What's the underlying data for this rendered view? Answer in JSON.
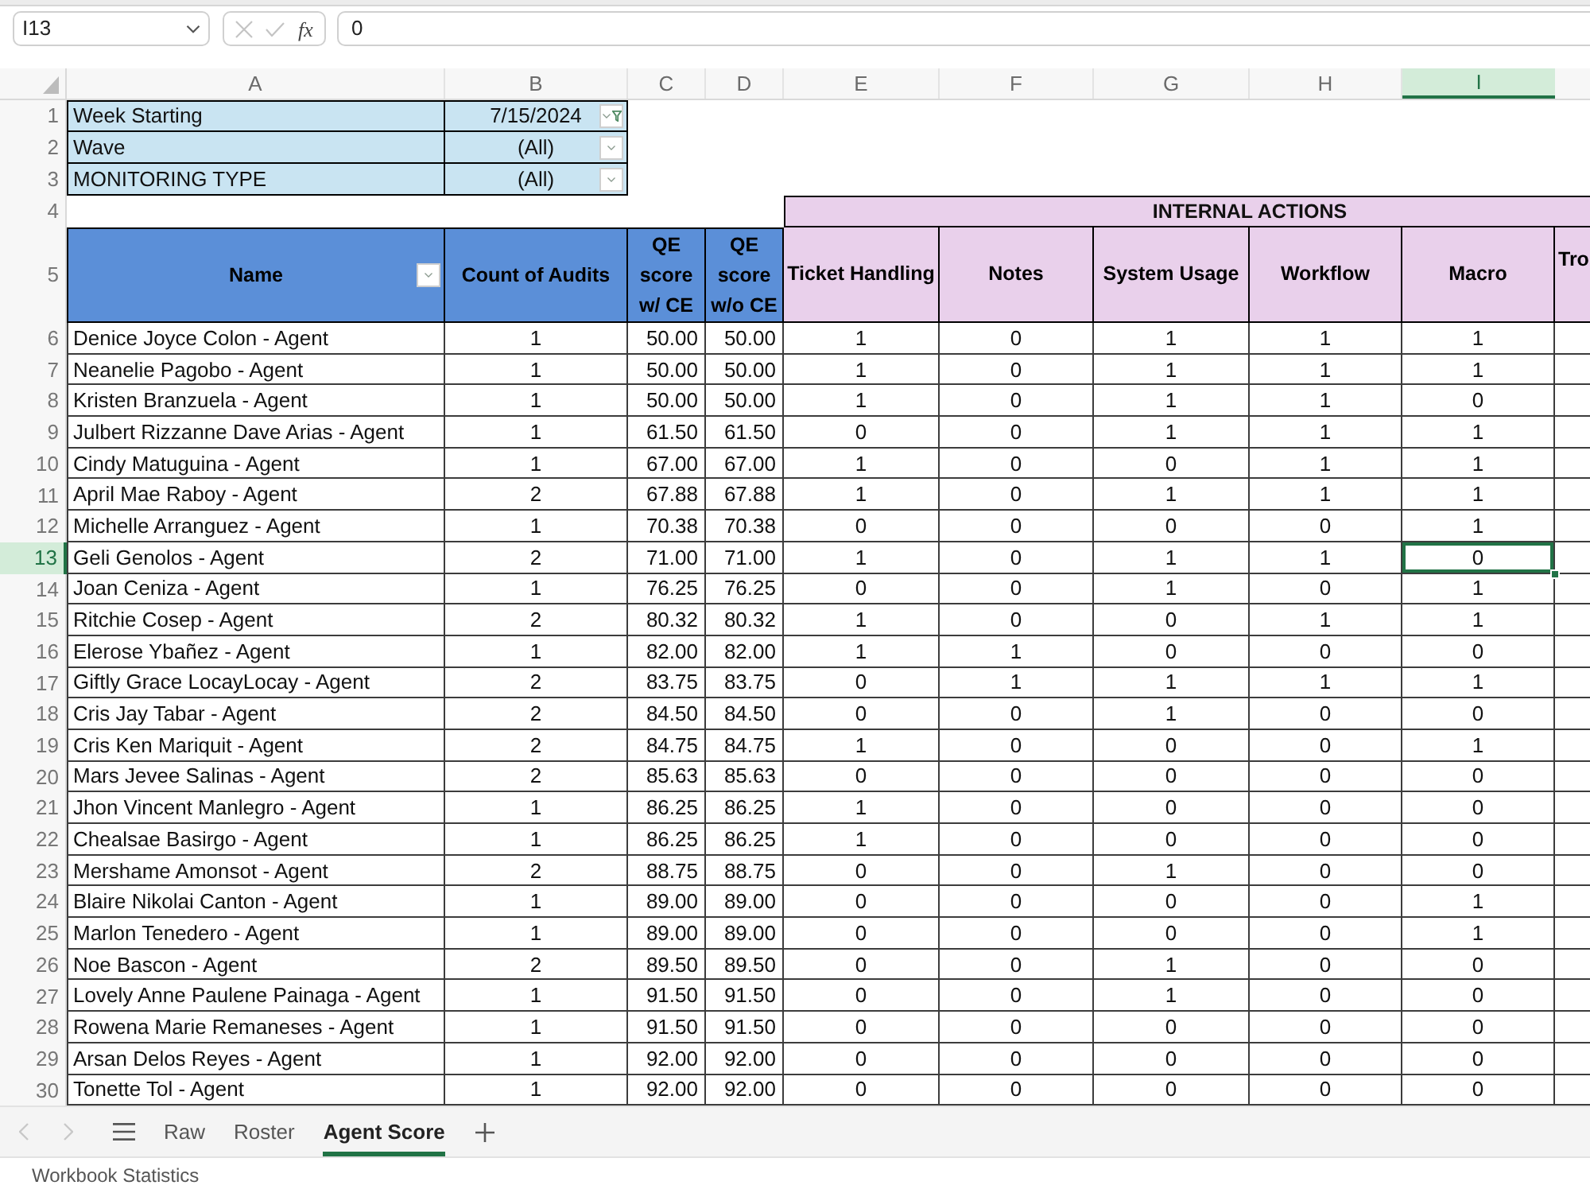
{
  "formula_bar": {
    "name_box": "I13",
    "function_label": "fx",
    "formula": "0",
    "editing": false
  },
  "columns": [
    {
      "label": "A",
      "selected": false
    },
    {
      "label": "B",
      "selected": false
    },
    {
      "label": "C",
      "selected": false
    },
    {
      "label": "D",
      "selected": false
    },
    {
      "label": "E",
      "selected": false
    },
    {
      "label": "F",
      "selected": false
    },
    {
      "label": "G",
      "selected": false
    },
    {
      "label": "H",
      "selected": false
    },
    {
      "label": "I",
      "selected": true
    }
  ],
  "filters": [
    {
      "row_number": "1",
      "label": "Week Starting",
      "value": "7/15/2024",
      "filtered": true
    },
    {
      "row_number": "2",
      "label": "Wave",
      "value": "(All)",
      "filtered": false
    },
    {
      "row_number": "3",
      "label": "MONITORING TYPE",
      "value": "(All)",
      "filtered": false
    }
  ],
  "group_row": {
    "row_number": "4",
    "label": "INTERNAL ACTIONS"
  },
  "header_row": {
    "row_number": "5",
    "cells": [
      {
        "text": "Name",
        "kind": "base",
        "dropdown": true
      },
      {
        "text": "Count of Audits",
        "kind": "base",
        "dropdown": false
      },
      {
        "text": "QE score w/ CE",
        "kind": "base",
        "dropdown": false
      },
      {
        "text": "QE score w/o CE",
        "kind": "base",
        "dropdown": false
      },
      {
        "text": "Ticket Handling",
        "kind": "action",
        "dropdown": false
      },
      {
        "text": "Notes",
        "kind": "action",
        "dropdown": false
      },
      {
        "text": "System Usage",
        "kind": "action",
        "dropdown": false
      },
      {
        "text": "Workflow",
        "kind": "action",
        "dropdown": false
      },
      {
        "text": "Macro",
        "kind": "action",
        "dropdown": false
      },
      {
        "text": "Tro",
        "kind": "action",
        "dropdown": false
      }
    ]
  },
  "rows": [
    {
      "row_number": "6",
      "selected": false,
      "cells": [
        "Denice Joyce Colon - Agent",
        "1",
        "50.00",
        "50.00",
        "1",
        "0",
        "1",
        "1",
        "1"
      ]
    },
    {
      "row_number": "7",
      "selected": false,
      "cells": [
        "Neanelie Pagobo - Agent",
        "1",
        "50.00",
        "50.00",
        "1",
        "0",
        "1",
        "1",
        "1"
      ]
    },
    {
      "row_number": "8",
      "selected": false,
      "cells": [
        "Kristen Branzuela - Agent",
        "1",
        "50.00",
        "50.00",
        "1",
        "0",
        "1",
        "1",
        "0"
      ]
    },
    {
      "row_number": "9",
      "selected": false,
      "cells": [
        "Julbert Rizzanne Dave Arias - Agent",
        "1",
        "61.50",
        "61.50",
        "0",
        "0",
        "1",
        "1",
        "1"
      ]
    },
    {
      "row_number": "10",
      "selected": false,
      "cells": [
        "Cindy Matuguina - Agent",
        "1",
        "67.00",
        "67.00",
        "1",
        "0",
        "0",
        "1",
        "1"
      ]
    },
    {
      "row_number": "11",
      "selected": false,
      "cells": [
        "April Mae Raboy - Agent",
        "2",
        "67.88",
        "67.88",
        "1",
        "0",
        "1",
        "1",
        "1"
      ]
    },
    {
      "row_number": "12",
      "selected": false,
      "cells": [
        "Michelle Arranguez - Agent",
        "1",
        "70.38",
        "70.38",
        "0",
        "0",
        "0",
        "0",
        "1"
      ]
    },
    {
      "row_number": "13",
      "selected": true,
      "cells": [
        "Geli Genolos - Agent",
        "2",
        "71.00",
        "71.00",
        "1",
        "0",
        "1",
        "1",
        "0"
      ]
    },
    {
      "row_number": "14",
      "selected": false,
      "cells": [
        "Joan Ceniza - Agent",
        "1",
        "76.25",
        "76.25",
        "0",
        "0",
        "1",
        "0",
        "1"
      ]
    },
    {
      "row_number": "15",
      "selected": false,
      "cells": [
        "Ritchie Cosep - Agent",
        "2",
        "80.32",
        "80.32",
        "1",
        "0",
        "0",
        "1",
        "1"
      ]
    },
    {
      "row_number": "16",
      "selected": false,
      "cells": [
        "Elerose Ybañez - Agent",
        "1",
        "82.00",
        "82.00",
        "1",
        "1",
        "0",
        "0",
        "0"
      ]
    },
    {
      "row_number": "17",
      "selected": false,
      "cells": [
        "Giftly Grace LocayLocay - Agent",
        "2",
        "83.75",
        "83.75",
        "0",
        "1",
        "1",
        "1",
        "1"
      ]
    },
    {
      "row_number": "18",
      "selected": false,
      "cells": [
        "Cris Jay Tabar - Agent",
        "2",
        "84.50",
        "84.50",
        "0",
        "0",
        "1",
        "0",
        "0"
      ]
    },
    {
      "row_number": "19",
      "selected": false,
      "cells": [
        "Cris Ken Mariquit - Agent",
        "2",
        "84.75",
        "84.75",
        "1",
        "0",
        "0",
        "0",
        "1"
      ]
    },
    {
      "row_number": "20",
      "selected": false,
      "cells": [
        "Mars Jevee Salinas - Agent",
        "2",
        "85.63",
        "85.63",
        "0",
        "0",
        "0",
        "0",
        "0"
      ]
    },
    {
      "row_number": "21",
      "selected": false,
      "cells": [
        "Jhon Vincent Manlegro - Agent",
        "1",
        "86.25",
        "86.25",
        "1",
        "0",
        "0",
        "0",
        "0"
      ]
    },
    {
      "row_number": "22",
      "selected": false,
      "cells": [
        "Chealsae Basirgo - Agent",
        "1",
        "86.25",
        "86.25",
        "1",
        "0",
        "0",
        "0",
        "0"
      ]
    },
    {
      "row_number": "23",
      "selected": false,
      "cells": [
        "Mershame Amonsot - Agent",
        "2",
        "88.75",
        "88.75",
        "0",
        "0",
        "1",
        "0",
        "0"
      ]
    },
    {
      "row_number": "24",
      "selected": false,
      "cells": [
        "Blaire Nikolai Canton - Agent",
        "1",
        "89.00",
        "89.00",
        "0",
        "0",
        "0",
        "0",
        "1"
      ]
    },
    {
      "row_number": "25",
      "selected": false,
      "cells": [
        "Marlon Tenedero - Agent",
        "1",
        "89.00",
        "89.00",
        "0",
        "0",
        "0",
        "0",
        "1"
      ]
    },
    {
      "row_number": "26",
      "selected": false,
      "cells": [
        "Noe Bascon - Agent",
        "2",
        "89.50",
        "89.50",
        "0",
        "0",
        "1",
        "0",
        "0"
      ]
    },
    {
      "row_number": "27",
      "selected": false,
      "cells": [
        "Lovely Anne Paulene Painaga - Agent",
        "1",
        "91.50",
        "91.50",
        "0",
        "0",
        "1",
        "0",
        "0"
      ]
    },
    {
      "row_number": "28",
      "selected": false,
      "cells": [
        "Rowena Marie Remaneses - Agent",
        "1",
        "91.50",
        "91.50",
        "0",
        "0",
        "0",
        "0",
        "0"
      ]
    },
    {
      "row_number": "29",
      "selected": false,
      "cells": [
        "Arsan Delos Reyes - Agent",
        "1",
        "92.00",
        "92.00",
        "0",
        "0",
        "0",
        "0",
        "0"
      ]
    },
    {
      "row_number": "30",
      "selected": false,
      "cells": [
        "Tonette Tol - Agent",
        "1",
        "92.00",
        "92.00",
        "0",
        "0",
        "0",
        "0",
        "0"
      ]
    }
  ],
  "sheet_nav": {
    "previous_enabled": false,
    "next_enabled": false
  },
  "tabs": [
    {
      "label": "Raw",
      "selected": false
    },
    {
      "label": "Roster",
      "selected": false
    },
    {
      "label": "Agent Score",
      "selected": true
    }
  ],
  "status_bar": {
    "text": "Workbook Statistics"
  }
}
